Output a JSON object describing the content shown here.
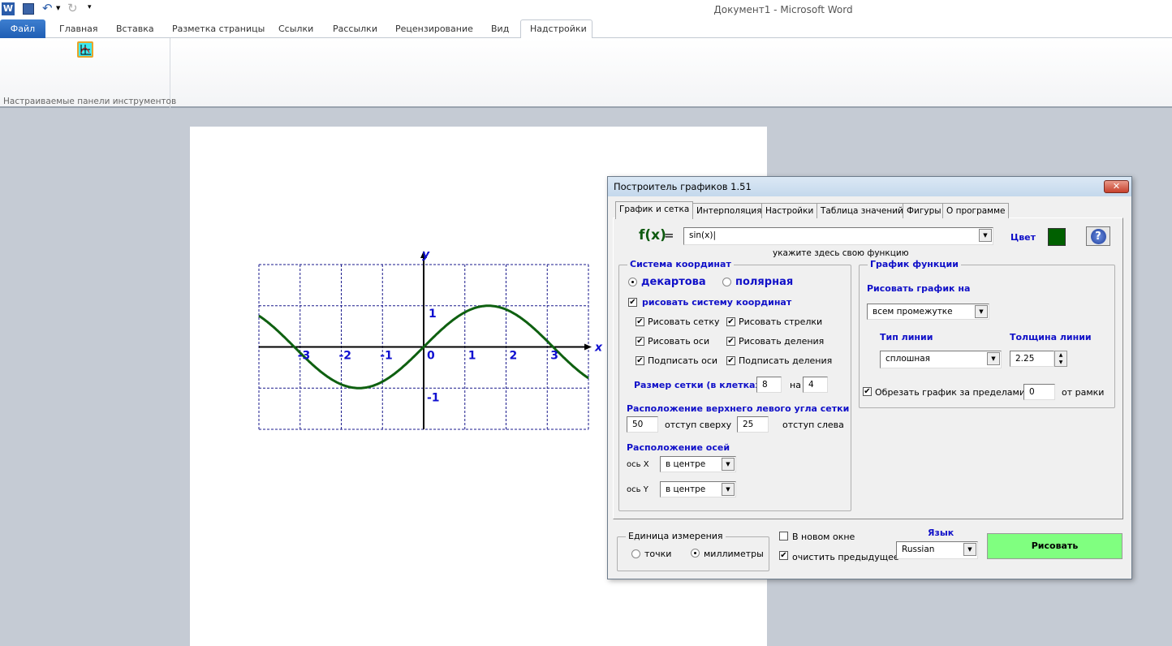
{
  "window": {
    "title": "Документ1 - Microsoft Word"
  },
  "ribbon": {
    "tabs": [
      "Файл",
      "Главная",
      "Вставка",
      "Разметка страницы",
      "Ссылки",
      "Рассылки",
      "Рецензирование",
      "Вид",
      "Надстройки"
    ],
    "active_tab": "Надстройки",
    "group_label": "Настраиваемые панели инструментов"
  },
  "dialog": {
    "title": "Построитель графиков 1.51",
    "tabs": [
      "График и сетка",
      "Интерполяция",
      "Настройки",
      "Таблица значений",
      "Фигуры",
      "О программе"
    ],
    "active_tab": "График и сетка",
    "fx_label": "f(x)",
    "eq": "=",
    "function_value": "sin(x)",
    "function_hint": "укажите здесь свою функцию",
    "color_label": "Цвет",
    "color": "#006000",
    "coord": {
      "legend": "Система координат",
      "radio_cartesian": "декартова",
      "radio_polar": "полярная",
      "selected": "декартова",
      "draw_system": "рисовать систему координат",
      "draw_system_checked": true,
      "checks": [
        {
          "label": "Рисовать сетку",
          "checked": true
        },
        {
          "label": "Рисовать стрелки",
          "checked": true
        },
        {
          "label": "Рисовать оси",
          "checked": true
        },
        {
          "label": "Рисовать деления",
          "checked": true
        },
        {
          "label": "Подписать оси",
          "checked": true
        },
        {
          "label": "Подписать деления",
          "checked": true
        }
      ],
      "grid_size_label": "Размер сетки (в клетках)",
      "grid_w": "8",
      "grid_by": "на",
      "grid_h": "4",
      "corner_label": "Расположение верхнего левого угла сетки",
      "top_offset": "50",
      "top_offset_label": "отступ сверху",
      "left_offset": "25",
      "left_offset_label": "отступ слева",
      "axes_label": "Расположение осей",
      "axis_x_label": "ось X",
      "axis_x_value": "в центре",
      "axis_y_label": "ось Y",
      "axis_y_value": "в центре"
    },
    "graph": {
      "legend": "График функции",
      "draw_on_label": "Рисовать график на",
      "draw_on_value": "всем промежутке",
      "line_type_label": "Тип линии",
      "line_type_value": "сплошная",
      "line_width_label": "Толщина линии",
      "line_width_value": "2.25",
      "clip_label": "Обрезать график за пределами",
      "clip_checked": true,
      "clip_value": "0",
      "clip_suffix": "от рамки"
    },
    "units": {
      "legend": "Единица измерения",
      "points": "точки",
      "mm": "миллиметры",
      "selected": "миллиметры"
    },
    "new_window": {
      "label": "В новом окне",
      "checked": false
    },
    "clear_prev": {
      "label": "очистить предыдущее",
      "checked": true
    },
    "language_label": "Язык",
    "language_value": "Russian",
    "draw_button": "Рисовать",
    "draw_button_color": "#80ff80"
  },
  "chart_data": {
    "type": "line",
    "function": "sin(x)",
    "xlim": [
      -4,
      4
    ],
    "ylim": [
      -2,
      2
    ],
    "grid": true,
    "xlabel": "x",
    "ylabel": "y",
    "x_ticks": [
      {
        "v": -3,
        "t": "-3"
      },
      {
        "v": -2,
        "t": "-2"
      },
      {
        "v": -1,
        "t": "-1"
      },
      {
        "v": 0,
        "t": "0"
      },
      {
        "v": 1,
        "t": "1"
      },
      {
        "v": 2,
        "t": "2"
      },
      {
        "v": 3,
        "t": "3"
      }
    ],
    "y_ticks": [
      {
        "v": 1,
        "t": "1"
      },
      {
        "v": -1,
        "t": "-1"
      }
    ],
    "line_color": "#0e6010",
    "grid_color": "#1a1a8c",
    "label_color": "#1010d0"
  }
}
